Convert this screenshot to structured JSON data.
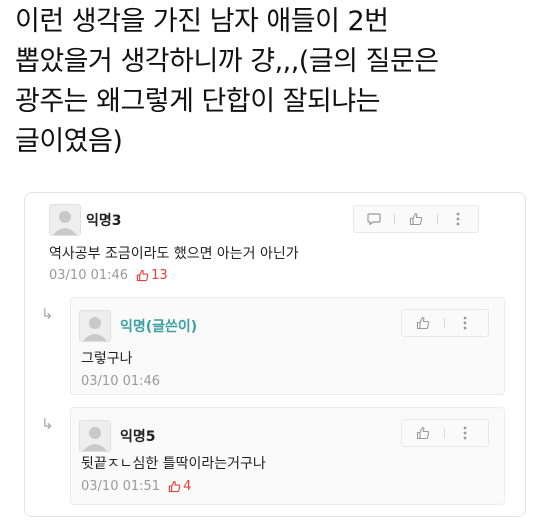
{
  "post": {
    "lines": [
      "이런 생각을 가진 남자 애들이 2번",
      "뽑았을거 생각하니까 걍,,,(글의 질문은",
      "광주는 왜그렇게 단합이 잘되냐는",
      "글이였음)"
    ]
  },
  "comments": [
    {
      "author": "익명3",
      "text": "역사공부 조금이라도 했으면 아는거 아닌가",
      "time": "03/10 01:46",
      "likes": "13",
      "icons": [
        "comment-icon",
        "thumbs-up-icon",
        "more-vertical-icon"
      ]
    }
  ],
  "replies": [
    {
      "author": "익명(글쓴이)",
      "text": "그렇구나",
      "time": "03/10 01:46",
      "likes": "",
      "icons": [
        "thumbs-up-icon",
        "more-vertical-icon"
      ]
    },
    {
      "author": "익명5",
      "text": "뒷끝ㅈㄴ심한 틀딱이라는거구나",
      "time": "03/10 01:51",
      "likes": "4",
      "icons": [
        "thumbs-up-icon",
        "more-vertical-icon"
      ]
    }
  ],
  "colors": {
    "like_red": "#e0433b",
    "op_author": "#3aa0a5",
    "meta_gray": "#9a9a9a"
  }
}
